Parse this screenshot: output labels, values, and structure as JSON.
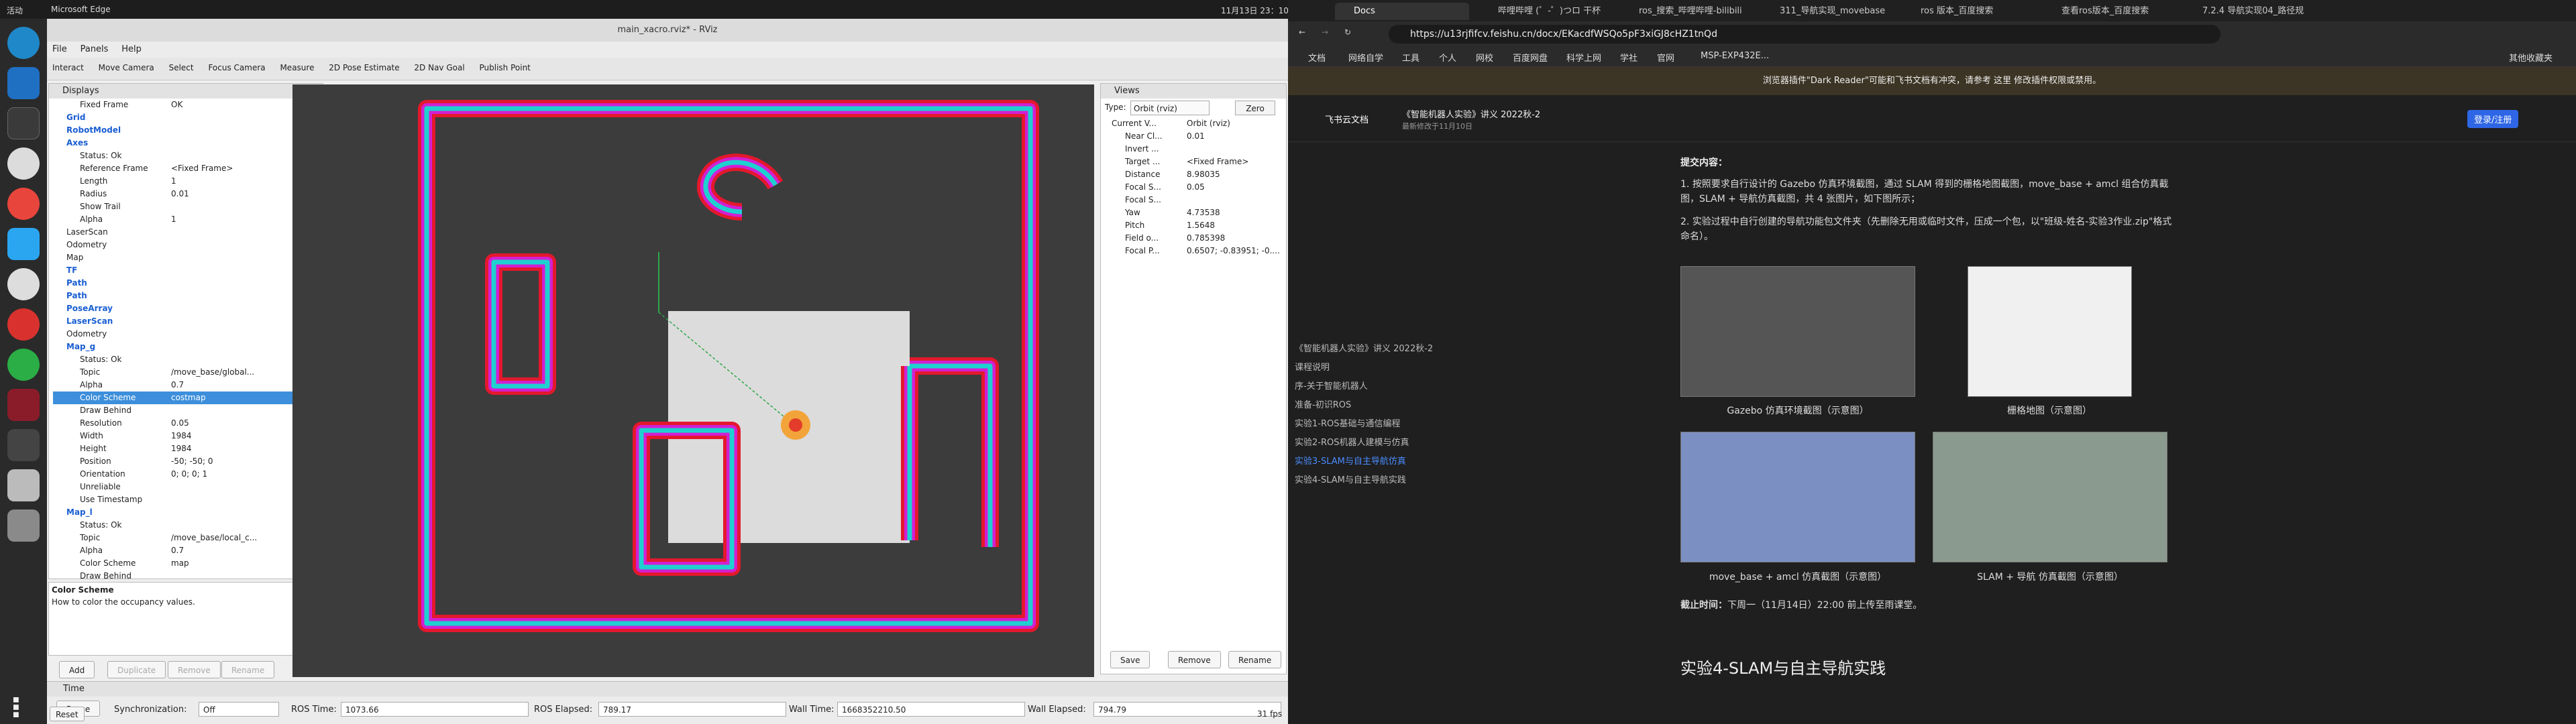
{
  "system": {
    "activities": "活动",
    "app_name": "Microsoft Edge",
    "clock": "11月13日 23：10"
  },
  "rviz": {
    "window_title": "main_xacro.rviz* - RViz",
    "menu": [
      "File",
      "Panels",
      "Help"
    ],
    "tools": [
      "Interact",
      "Move Camera",
      "Select",
      "Focus Camera",
      "Measure",
      "2D Pose Estimate",
      "2D Nav Goal",
      "Publish Point"
    ],
    "displays_title": "Displays",
    "rows": [
      {
        "k": "Fixed Frame",
        "v": "OK",
        "b": false
      },
      {
        "k": "Grid",
        "v": "",
        "b": true
      },
      {
        "k": "RobotModel",
        "v": "",
        "b": true
      },
      {
        "k": "Axes",
        "v": "",
        "b": true
      },
      {
        "k": "Status: Ok",
        "v": "",
        "b": false
      },
      {
        "k": "Reference Frame",
        "v": "<Fixed Frame>",
        "b": false
      },
      {
        "k": "Length",
        "v": "1",
        "b": false
      },
      {
        "k": "Radius",
        "v": "0.01",
        "b": false
      },
      {
        "k": "Show Trail",
        "v": "",
        "b": false
      },
      {
        "k": "Alpha",
        "v": "1",
        "b": false
      },
      {
        "k": "LaserScan",
        "v": "",
        "b": false
      },
      {
        "k": "Odometry",
        "v": "",
        "b": false
      },
      {
        "k": "Map",
        "v": "",
        "b": false
      },
      {
        "k": "TF",
        "v": "",
        "b": true
      },
      {
        "k": "Path",
        "v": "",
        "b": true
      },
      {
        "k": "Path",
        "v": "",
        "b": true
      },
      {
        "k": "PoseArray",
        "v": "",
        "b": true
      },
      {
        "k": "LaserScan",
        "v": "",
        "b": true
      },
      {
        "k": "Odometry",
        "v": "",
        "b": false
      },
      {
        "k": "Map_g",
        "v": "",
        "b": true
      },
      {
        "k": "Status: Ok",
        "v": "",
        "b": false
      },
      {
        "k": "Topic",
        "v": "/move_base/global...",
        "b": false
      },
      {
        "k": "Alpha",
        "v": "0.7",
        "b": false
      },
      {
        "k": "Color Scheme",
        "v": "costmap",
        "b": false
      },
      {
        "k": "Draw Behind",
        "v": "",
        "b": false
      },
      {
        "k": "Resolution",
        "v": "0.05",
        "b": false
      },
      {
        "k": "Width",
        "v": "1984",
        "b": false
      },
      {
        "k": "Height",
        "v": "1984",
        "b": false
      },
      {
        "k": "Position",
        "v": "-50; -50; 0",
        "b": false
      },
      {
        "k": "Orientation",
        "v": "0; 0; 0; 1",
        "b": false
      },
      {
        "k": "Unreliable",
        "v": "",
        "b": false
      },
      {
        "k": "Use Timestamp",
        "v": "",
        "b": false
      },
      {
        "k": "Map_l",
        "v": "",
        "b": true
      },
      {
        "k": "Status: Ok",
        "v": "",
        "b": false
      },
      {
        "k": "Topic",
        "v": "/move_base/local_c...",
        "b": false
      },
      {
        "k": "Alpha",
        "v": "0.7",
        "b": false
      },
      {
        "k": "Color Scheme",
        "v": "map",
        "b": false
      },
      {
        "k": "Draw Behind",
        "v": "",
        "b": false
      }
    ],
    "desc_title": "Color Scheme",
    "desc_text": "How to color the occupancy values.",
    "disp_buttons": [
      "Add",
      "Duplicate",
      "Remove",
      "Rename"
    ],
    "views_title": "Views",
    "views_type_label": "Type:",
    "views_type": "Orbit (rviz)",
    "views_zero": "Zero",
    "view_rows": [
      {
        "k": "Current V...",
        "v": "Orbit (rviz)"
      },
      {
        "k": "Near Cl...",
        "v": "0.01"
      },
      {
        "k": "Invert ...",
        "v": ""
      },
      {
        "k": "Target ...",
        "v": "<Fixed Frame>"
      },
      {
        "k": "Distance",
        "v": "8.98035"
      },
      {
        "k": "Focal S...",
        "v": "0.05"
      },
      {
        "k": "Focal S...",
        "v": ""
      },
      {
        "k": "Yaw",
        "v": "4.73538"
      },
      {
        "k": "Pitch",
        "v": "1.5648"
      },
      {
        "k": "Field o...",
        "v": "0.785398"
      },
      {
        "k": "Focal P...",
        "v": "0.6507; -0.83951; -0...."
      }
    ],
    "view_buttons": [
      "Save",
      "Remove",
      "Rename"
    ],
    "time_title": "Time",
    "pause": "Pause",
    "sync_label": "Synchronization:",
    "sync_value": "Off",
    "ros_time_label": "ROS Time:",
    "ros_time": "1073.66",
    "ros_elapsed_label": "ROS Elapsed:",
    "ros_elapsed": "789.17",
    "wall_time_label": "Wall Time:",
    "wall_time": "1668352210.50",
    "wall_elapsed_label": "Wall Elapsed:",
    "wall_elapsed": "794.79",
    "reset": "Reset",
    "fps": "31 fps"
  },
  "browser": {
    "tabs": [
      "Docs",
      "哔哩哔哩 (゜-゜)つロ 干杯",
      "ros_搜索_哔哩哔哩-bilibili",
      "311_导航实现_movebase",
      "ros 版本_百度搜索",
      "查看ros版本_百度搜索",
      "7.2.4 导航实现04_路径规"
    ],
    "url": "https://u13rjfifcv.feishu.cn/docx/EKacdfWSQo5pF3xiGJ8cHZ1tnQd",
    "favorites": [
      "文档",
      "网络自学",
      "工具",
      "个人",
      "网校",
      "百度网盘",
      "科学上网",
      "学社",
      "官网",
      "MSP-EXP432E..."
    ],
    "other_fav": "其他收藏夹",
    "warning": "浏览器插件\"Dark Reader\"可能和飞书文档有冲突，请参考 这里 修改插件权限或禁用。",
    "brand": "飞书云文档",
    "doc_title": "《智能机器人实验》讲义 2022秋-2",
    "doc_sub": "最新修改于11月10日",
    "login": "登录/注册",
    "outline": [
      "《智能机器人实验》讲义 2022秋-2",
      "课程说明",
      "序-关于智能机器人",
      "准备-初识ROS",
      "实验1-ROS基础与通信编程",
      "实验2-ROS机器人建模与仿真",
      "实验3-SLAM与自主导航仿真",
      "实验4-SLAM与自主导航实践"
    ],
    "outline_active": 6,
    "submit_title": "提交内容：",
    "item1": "按照要求自行设计的 Gazebo 仿真环境截图，通过 SLAM 得到的栅格地图截图，move_base + amcl 组合仿真截图，SLAM + 导航仿真截图，共 4 张图片，如下图所示；",
    "item2": "实验过程中自行创建的导航功能包文件夹（先删除无用或临时文件，压成一个包，以\"班级-姓名-实验3作业.zip\"格式命名）。",
    "captions": [
      "Gazebo 仿真环境截图（示意图）",
      "栅格地图（示意图）",
      "move_base + amcl 仿真截图（示意图）",
      "SLAM + 导航 仿真截图（示意图）"
    ],
    "deadline_label": "截止时间：",
    "deadline": "下周一（11月14日）22:00 前上传至雨课堂。",
    "section": "实验4-SLAM与自主导航实践",
    "accent": "#4a8cff"
  }
}
